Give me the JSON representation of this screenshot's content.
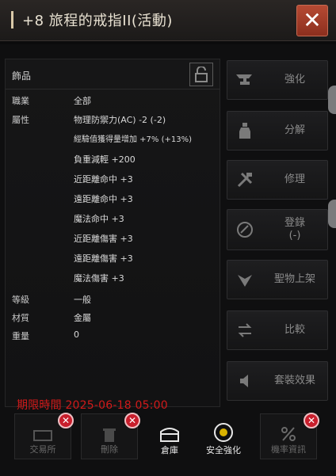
{
  "window": {
    "title": "+8 旅程的戒指II(活動)",
    "close_icon": "close-x-icon"
  },
  "info": {
    "header_label": "飾品",
    "lock_icon": "unlock-icon",
    "rows": [
      {
        "key": "職業",
        "value": "全部"
      },
      {
        "key": "屬性",
        "value": "物理防禦力(AC) -2 (-2)"
      },
      {
        "key": "",
        "value": "經驗值獲得量增加 +7% (+13%)"
      },
      {
        "key": "",
        "value": "負重減輕 +200"
      },
      {
        "key": "",
        "value": "近距離命中 +3"
      },
      {
        "key": "",
        "value": "遠距離命中 +3"
      },
      {
        "key": "",
        "value": "魔法命中 +3"
      },
      {
        "key": "",
        "value": "近距離傷害 +3"
      },
      {
        "key": "",
        "value": "遠距離傷害 +3"
      },
      {
        "key": "",
        "value": "魔法傷害 +3"
      },
      {
        "key": "等級",
        "value": "一般"
      },
      {
        "key": "材質",
        "value": "金屬"
      },
      {
        "key": "重量",
        "value": "0"
      }
    ],
    "expire_text": "期限時間 2025-06-18 05:00"
  },
  "side_buttons": [
    {
      "label": "強化",
      "icon": "anvil-icon"
    },
    {
      "label": "分解",
      "icon": "bottle-icon"
    },
    {
      "label": "修理",
      "icon": "hammer-wrench-icon"
    },
    {
      "label": "登錄\n(-)",
      "icon": "register-icon"
    },
    {
      "label": "聖物上架",
      "icon": "relic-icon"
    },
    {
      "label": "比較",
      "icon": "compare-arrows-icon"
    },
    {
      "label": "套裝效果",
      "icon": "speaker-icon"
    }
  ],
  "bottom_tools": [
    {
      "label": "交易所",
      "icon": "exchange-icon",
      "disabled": true
    },
    {
      "label": "刪除",
      "icon": "trash-icon",
      "disabled": true
    },
    {
      "label": "倉庫",
      "icon": "chest-icon",
      "disabled": false
    },
    {
      "label": "安全強化",
      "icon": "safe-enhance-icon",
      "disabled": false
    },
    {
      "label": "機率資訊",
      "icon": "percent-icon",
      "disabled": true
    }
  ],
  "colors": {
    "expire": "#d11a1a",
    "close_bg": "#b64a33",
    "badge": "#c81e2c"
  }
}
